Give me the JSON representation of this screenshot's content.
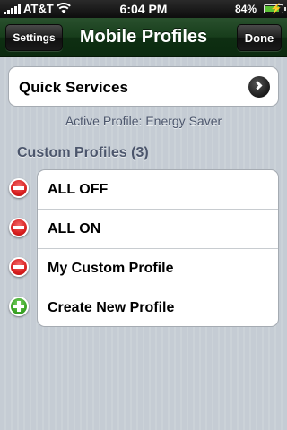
{
  "status_bar": {
    "carrier": "AT&T",
    "time": "6:04 PM",
    "battery_percent_label": "84%",
    "battery_level": 0.84,
    "signal_icon": "signal-bars-icon",
    "wifi_icon": "wifi-icon",
    "battery_icon": "battery-charging-icon"
  },
  "nav_bar": {
    "title": "Mobile Profiles",
    "left_button_label": "Settings",
    "right_button_label": "Done",
    "background_color": "#1b3f1f"
  },
  "quick_services": {
    "label": "Quick Services",
    "accessory_icon": "disclosure-arrow-icon"
  },
  "active_profile_text": "Active Profile: Energy Saver",
  "custom_profiles": {
    "header": "Custom Profiles (3)",
    "items": [
      {
        "label": "ALL OFF",
        "action": "delete",
        "icon": "minus-circle-icon"
      },
      {
        "label": "ALL ON",
        "action": "delete",
        "icon": "minus-circle-icon"
      },
      {
        "label": "My Custom Profile",
        "action": "delete",
        "icon": "minus-circle-icon"
      },
      {
        "label": "Create New Profile",
        "action": "add",
        "icon": "plus-circle-icon"
      }
    ]
  },
  "colors": {
    "delete": "#d81e1e",
    "add": "#3ba526",
    "group_header_text": "#4c566c"
  }
}
